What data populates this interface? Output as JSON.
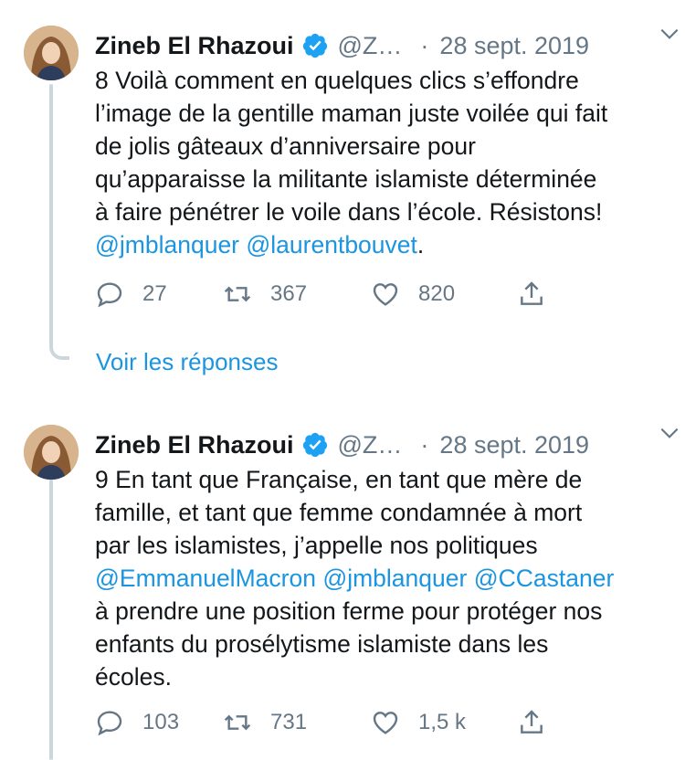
{
  "colors": {
    "link": "#1b95e0",
    "muted": "#657786",
    "text": "#14171a",
    "thread": "#ccd6dd",
    "verified": "#1da1f2"
  },
  "tweets": [
    {
      "name": "Zineb El Rhazoui",
      "handle": "@Z…",
      "separator": "·",
      "date": "28 sept. 2019",
      "text_lines": [
        [
          {
            "t": "8 Voilà comment en quelques clics s’effondre"
          }
        ],
        [
          {
            "t": "l’image de la gentille maman juste voilée qui fait"
          }
        ],
        [
          {
            "t": "de jolis gâteaux d’anniversaire pour"
          }
        ],
        [
          {
            "t": "qu’apparaisse la militante islamiste déterminée"
          }
        ],
        [
          {
            "t": "à faire pénétrer le voile dans l’école. Résistons!"
          }
        ],
        [
          {
            "t": "@jmblanquer",
            "m": true
          },
          {
            "t": " "
          },
          {
            "t": "@laurentbouvet",
            "m": true
          },
          {
            "t": "."
          }
        ]
      ],
      "replies": "27",
      "retweets": "367",
      "likes": "820"
    },
    {
      "name": "Zineb El Rhazoui",
      "handle": "@Z…",
      "separator": "·",
      "date": "28 sept. 2019",
      "text_lines": [
        [
          {
            "t": "9 En tant que Française, en tant que mère de"
          }
        ],
        [
          {
            "t": "famille, et tant que femme condamnée à mort"
          }
        ],
        [
          {
            "t": "par les islamistes, j’appelle nos politiques"
          }
        ],
        [
          {
            "t": "@EmmanuelMacron",
            "m": true
          },
          {
            "t": " "
          },
          {
            "t": "@jmblanquer",
            "m": true
          },
          {
            "t": " "
          },
          {
            "t": "@CCastaner",
            "m": true
          }
        ],
        [
          {
            "t": "à prendre une position ferme pour protéger nos"
          }
        ],
        [
          {
            "t": "enfants du prosélytisme islamiste dans les"
          }
        ],
        [
          {
            "t": "écoles."
          }
        ]
      ],
      "replies": "103",
      "retweets": "731",
      "likes": "1,5 k"
    }
  ],
  "show_replies_label": "Voir les réponses",
  "icons": [
    "reply-icon",
    "retweet-icon",
    "like-icon",
    "share-icon",
    "verified-badge-icon",
    "chevron-down-icon"
  ]
}
